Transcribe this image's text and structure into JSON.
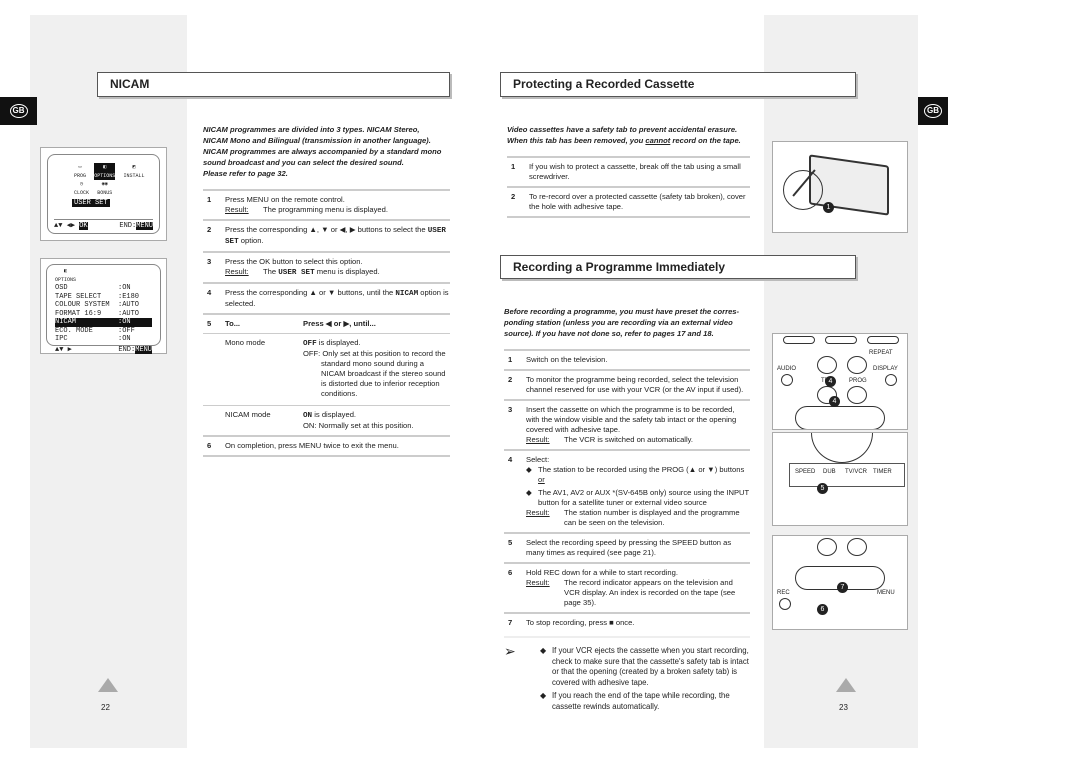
{
  "lang_tab": "GB",
  "left": {
    "title": "NICAM",
    "intro": [
      "NICAM programmes are divided into 3 types. NICAM Stereo,",
      "NICAM Mono and Bilingual (transmission in another language).",
      "NICAM programmes are always accompanied by a standard mono",
      "sound broadcast and you can select the desired sound.",
      "Please refer to page 32."
    ],
    "steps": [
      {
        "n": "1",
        "text": "Press MENU on the remote control.",
        "result_label": "Result:",
        "result": "The programming menu is displayed."
      },
      {
        "n": "2",
        "pre": "Press the corresponding ▲, ▼ or ◀, ▶ buttons to select the",
        "mono": "USER SET",
        "post": " option."
      },
      {
        "n": "3",
        "text": "Press the OK button to select this option.",
        "result_label": "Result:",
        "result_pre": "The ",
        "result_mono": "USER SET",
        "result_post": " menu is displayed."
      },
      {
        "n": "4",
        "pre": "Press the corresponding ▲ or ▼ buttons, until the ",
        "mono": "NICAM",
        "post": " option is selected."
      },
      {
        "n": "5",
        "col1": "To...",
        "col2": "Press ◀ or ▶, until...",
        "rows": [
          {
            "mode": "Mono mode",
            "value": "OFF",
            "value_text": " is displayed.",
            "note": "OFF: Only set at this position to record the standard mono sound during a NICAM broadcast if the stereo sound is distorted due to inferior reception conditions."
          },
          {
            "mode": "NICAM mode",
            "value": "ON",
            "value_text": " is displayed.",
            "note": "ON: Normally set at this position."
          }
        ]
      },
      {
        "n": "6",
        "text": "On completion, press MENU twice to exit the menu."
      }
    ],
    "screen1": {
      "icons": [
        "PROG",
        "OPTIONS",
        "INSTALL",
        "CLOCK",
        "BONUS"
      ],
      "selected": "USER SET",
      "nav": "▲▼ ◀▶",
      "ok": "OK",
      "end": "END:",
      "menu": "MENU"
    },
    "screen2": {
      "icon": "OPTIONS",
      "rows": [
        [
          "OSD",
          ":ON"
        ],
        [
          "TAPE SELECT",
          ":E180"
        ],
        [
          "COLOUR SYSTEM",
          ":AUTO"
        ],
        [
          "FORMAT 16:9",
          ":AUTO"
        ],
        [
          "NICAM",
          ":ON"
        ],
        [
          "ECO. MODE",
          ":OFF"
        ],
        [
          "IPC",
          ":ON"
        ]
      ],
      "highlight_index": 4,
      "nav": "▲▼  ▶",
      "end": "END:",
      "menu": "MENU"
    },
    "page": "22"
  },
  "right": {
    "protect": {
      "title": "Protecting a Recorded Cassette",
      "intro": [
        "Video cassettes have a safety tab to prevent accidental erasure.",
        "When this tab has been removed, you "
      ],
      "intro_u": "cannot",
      "intro_end": " record on the tape.",
      "steps": [
        {
          "n": "1",
          "text": "If you wish to protect a cassette, break off the tab using a small screwdriver."
        },
        {
          "n": "2",
          "text": "To re-record over a protected cassette (safety tab broken), cover the hole with adhesive tape."
        }
      ],
      "callout": "1"
    },
    "record": {
      "title": "Recording a Programme Immediately",
      "intro": [
        "Before recording a programme, you must have preset the corres-",
        "ponding station (unless you are recording via an external video",
        "source). If you have not done so, refer to pages 17 and 18."
      ],
      "steps": [
        {
          "n": "1",
          "text": "Switch on the television."
        },
        {
          "n": "2",
          "text": "To monitor the programme being recorded, select the television channel reserved for use with your VCR (or the AV input if used)."
        },
        {
          "n": "3",
          "text": "Insert the cassette on which the programme is to be recorded, with the window visible and the safety tab intact or the opening covered with adhesive tape.",
          "result_label": "Result:",
          "result": "The VCR is switched on automatically."
        },
        {
          "n": "4",
          "text": "Select:",
          "b1": "The station to be recorded using the PROG (▲ or ▼) buttons",
          "or": "or",
          "b2": "The AV1, AV2 or AUX *(SV-645B only) source using the INPUT button for a satellite tuner or external video source",
          "result_label": "Result:",
          "result": "The station number is displayed and the programme can be seen on the television."
        },
        {
          "n": "5",
          "text": "Select the recording speed by pressing the SPEED button as many times as required (see page 21)."
        },
        {
          "n": "6",
          "text": "Hold REC down for a while to start recording.",
          "result_label": "Result:",
          "result": "The record indicator appears on the television and VCR display. An index is recorded on the tape (see page 35)."
        },
        {
          "n": "7",
          "text": "To stop recording, press ■ once."
        }
      ],
      "notes": [
        "If your VCR ejects the cassette when you start recording, check to make sure that the cassette's safety tab is intact or that the opening (created by a broken safety tab) is covered with adhesive tape.",
        "If you reach the end of the tape while recording, the cassette rewinds automatically."
      ],
      "remote1": {
        "labels": [
          "REPEAT",
          "AUDIO",
          "DISPLAY",
          "TRK",
          "PROG"
        ],
        "callouts": [
          "4",
          "4"
        ]
      },
      "remote2": {
        "labels": [
          "SPEED",
          "DUB",
          "TV/VCR",
          "TIMER"
        ],
        "callout": "5"
      },
      "remote3": {
        "labels": [
          "REC",
          "MENU"
        ],
        "callouts": [
          "7",
          "6"
        ]
      }
    },
    "page": "23"
  }
}
